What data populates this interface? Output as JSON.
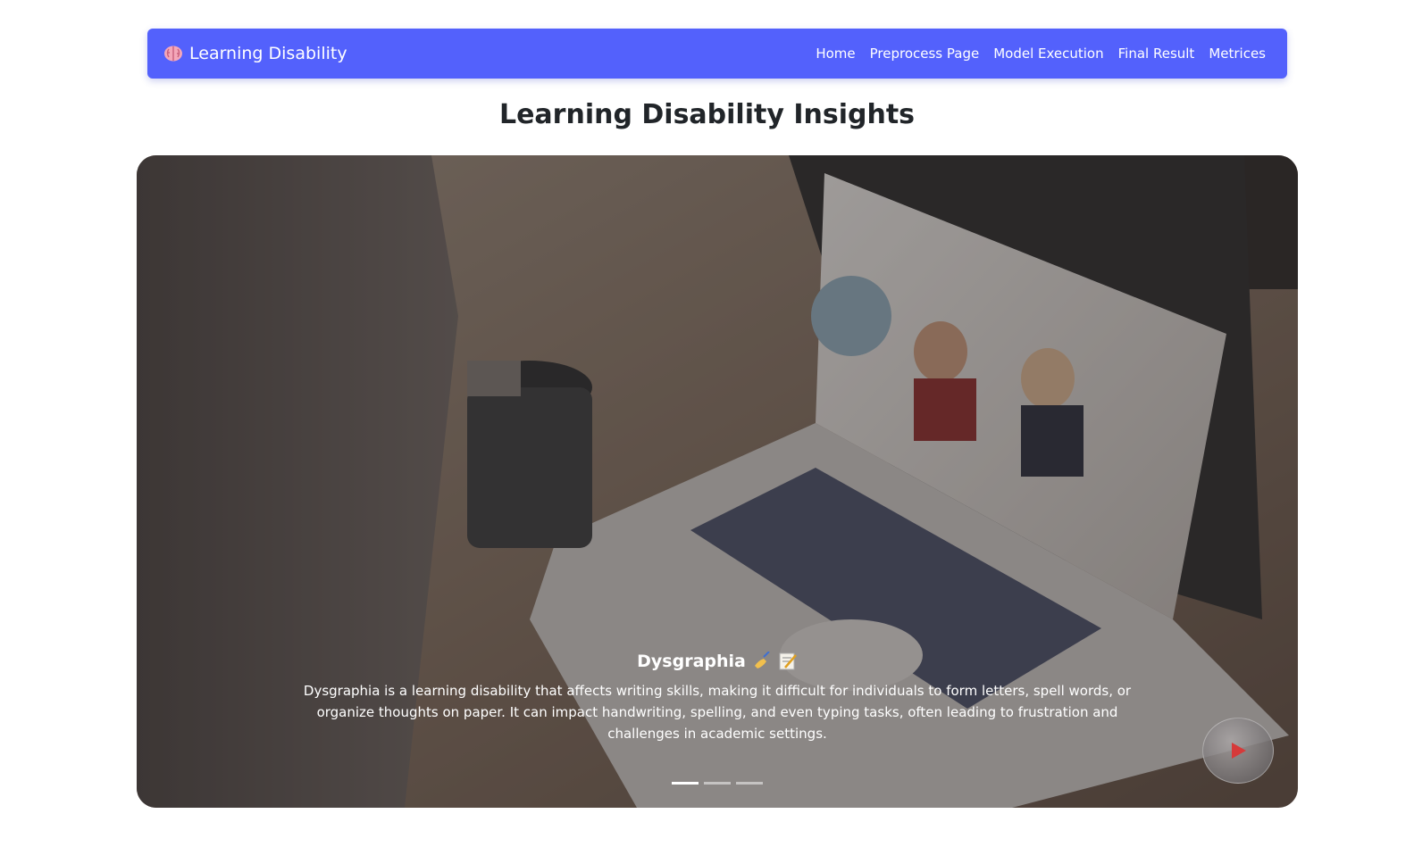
{
  "nav": {
    "brand": "Learning Disability",
    "links": [
      "Home",
      "Preprocess Page",
      "Model Execution",
      "Final Result",
      "Metrices"
    ]
  },
  "page": {
    "title": "Learning Disability Insights"
  },
  "carousel": {
    "active_slide": 1,
    "slide_count": 3,
    "slide": {
      "title": "Dysgraphia",
      "text": "Dysgraphia is a learning disability that affects writing skills, making it difficult for individuals to form letters, spell words, or organize thoughts on paper. It can impact handwriting, spelling, and even typing tasks, often leading to frustration and challenges in academic settings."
    }
  },
  "icons": {
    "brand": "brain-icon",
    "caption": [
      "writing-hand-icon",
      "memo-icon"
    ],
    "play": "play-icon"
  },
  "colors": {
    "navbar": "#5361fc",
    "play_arrow": "#d63a3a"
  }
}
